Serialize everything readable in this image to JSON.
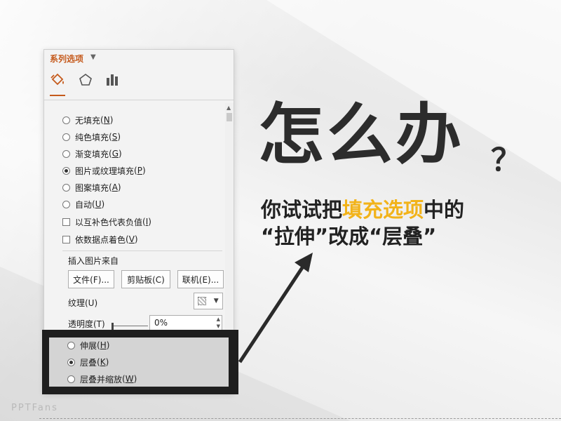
{
  "panel": {
    "title": "系列选项",
    "tabs": [
      {
        "name": "fill-line-tab",
        "icon": "paint-bucket-icon"
      },
      {
        "name": "effects-tab",
        "icon": "pentagon-icon"
      },
      {
        "name": "series-options-tab",
        "icon": "bar-chart-icon"
      }
    ],
    "fill_options": [
      {
        "label": "无填充",
        "key": "N",
        "type": "radio",
        "checked": false
      },
      {
        "label": "纯色填充",
        "key": "S",
        "type": "radio",
        "checked": false
      },
      {
        "label": "渐变填充",
        "key": "G",
        "type": "radio",
        "checked": false
      },
      {
        "label": "图片或纹理填充",
        "key": "P",
        "type": "radio",
        "checked": true
      },
      {
        "label": "图案填充",
        "key": "A",
        "type": "radio",
        "checked": false
      },
      {
        "label": "自动",
        "key": "U",
        "type": "radio",
        "checked": false
      },
      {
        "label": "以互补色代表负值",
        "key": "I",
        "type": "checkbox",
        "checked": false
      },
      {
        "label": "依数据点着色",
        "key": "V",
        "type": "checkbox",
        "checked": false
      }
    ],
    "insert_from_label": "插入图片来自",
    "buttons": {
      "file": "文件(F)...",
      "clipboard": "剪贴板(C)",
      "online": "联机(E)..."
    },
    "texture_label": "纹理(U)",
    "transparency_label": "透明度(T)",
    "transparency_value": "0%",
    "stretch_options": [
      {
        "label": "伸展",
        "key": "H",
        "checked": false
      },
      {
        "label": "层叠",
        "key": "K",
        "checked": true
      },
      {
        "label": "层叠并缩放",
        "key": "W",
        "checked": false
      }
    ]
  },
  "headline": {
    "big": "怎么办",
    "question": "？",
    "line1_pre": "你试试把",
    "line1_hl": "填充选项",
    "line1_post": "中的",
    "line2": "“拉伸”改成“层叠”"
  },
  "watermark": "PPTFans",
  "colors": {
    "accent": "#c55a1c",
    "highlight": "#f2b31a",
    "dark": "#2c2c2c"
  }
}
